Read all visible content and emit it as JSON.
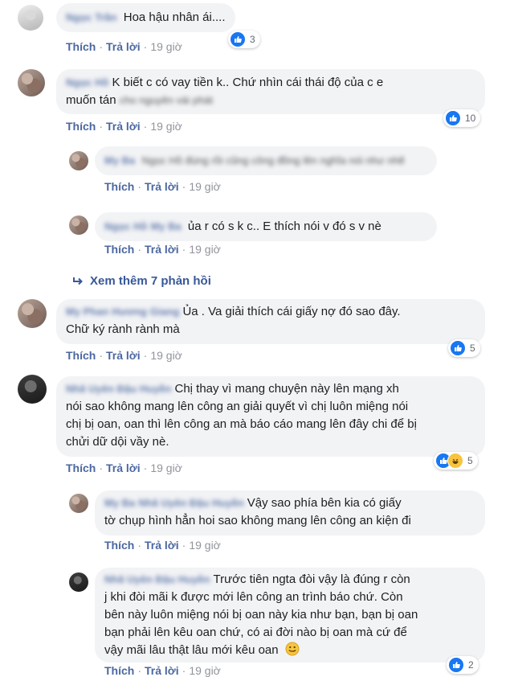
{
  "labels": {
    "like": "Thích",
    "reply": "Trả lời",
    "sep": "·"
  },
  "comments": [
    {
      "name": "Ngọc Trần",
      "text": "Hoa hậu nhân ái....",
      "time": "19 giờ",
      "reactions": "3"
    },
    {
      "name": "Ngọc Hồ",
      "text1": "K biết c có vay tiền k.. Chứ nhìn cái thái độ của c e",
      "text2": "muốn tán",
      "text2_blur": "cho nguyên vài phát",
      "time": "19 giờ",
      "reactions": "10"
    },
    {
      "name": "My Ba",
      "text_blur": "Ngọc Hồ đúng rồi cũng công đồng lên nghĩa nói như nhẽ",
      "time": "19 giờ"
    },
    {
      "name": "Ngọc Hồ",
      "mention": "My Ba",
      "text": "ủa r có s k c.. E thích nói v đó s v nè",
      "time": "19 giờ"
    },
    {
      "name": "My Phan Hương Giang",
      "text1": "Ủa . Va giải thích cái giấy nợ đó sao đây.",
      "text2": "Chữ ký rành rành mà",
      "time": "19 giờ",
      "reactions": "5"
    },
    {
      "name": "Nhã Uyên Đậu Huyền",
      "lines": [
        "Chị thay vì mang chuyện này lên mạng xh",
        "nói sao không mang lên công an giải quyết vì chị luôn miệng nói",
        "chị bị oan, oan thì lên công an mà báo cáo mang lên đây chi để bị",
        "chửi dữ dội vầy nè."
      ],
      "time": "19 giờ",
      "reactions": "5"
    },
    {
      "name": "My Ba",
      "mention": "Nhã Uyên Đậu Huyền",
      "lines": [
        "Vậy sao phía bên kia có giấy",
        "tờ chụp hình hẳn hoi sao không mang lên công an kiện đi"
      ],
      "time": "19 giờ"
    },
    {
      "name": "Nhã Uyên Đậu Huyền",
      "lines": [
        "Trước tiên ngta đòi vậy là đúng r còn",
        "j khi đòi mãi k được mới lên công an trình báo chứ. Còn",
        "bên này luôn miệng nói bị oan này kia như bạn, bạn bị oan",
        "bạn phải lên kêu oan chứ, có ai đời nào bị oan mà cứ để",
        "vậy mãi lâu thật lâu mới kêu oan"
      ],
      "time": "19 giờ",
      "reactions": "2"
    }
  ],
  "view_more": "Xem thêm 7 phản hồi",
  "icons": {
    "like": "like-icon",
    "haha": "haha-icon",
    "reply_arrow": "reply-arrow-icon",
    "smile": "smile-emoji-icon"
  },
  "colors": {
    "link": "#385898",
    "bubble": "#f2f3f5",
    "like_blue": "#1877f2",
    "muted": "#90949c"
  }
}
